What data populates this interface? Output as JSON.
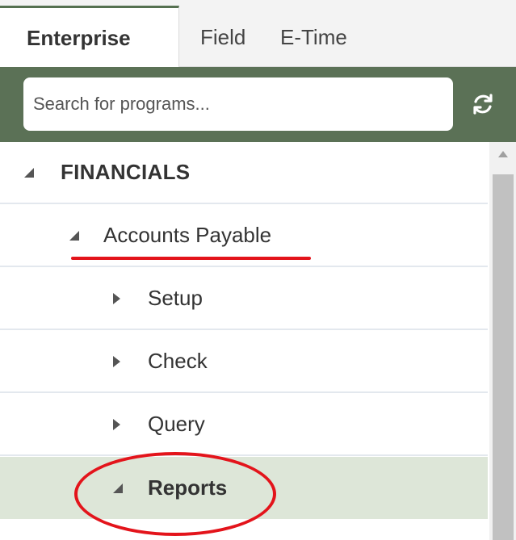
{
  "tabs": [
    {
      "label": "Enterprise",
      "active": true
    },
    {
      "label": "Field",
      "active": false
    },
    {
      "label": "E-Time",
      "active": false
    }
  ],
  "search": {
    "placeholder": "Search for programs...",
    "value": "",
    "refresh_icon": "refresh-icon"
  },
  "tree": {
    "items": [
      {
        "label": "FINANCIALS",
        "expanded": true,
        "icon": "caret-expanded-icon"
      },
      {
        "label": "Accounts Payable",
        "expanded": true,
        "icon": "caret-expanded-icon"
      },
      {
        "label": "Setup",
        "expanded": false,
        "icon": "caret-collapsed-icon"
      },
      {
        "label": "Check",
        "expanded": false,
        "icon": "caret-collapsed-icon"
      },
      {
        "label": "Query",
        "expanded": false,
        "icon": "caret-collapsed-icon"
      },
      {
        "label": "Reports",
        "expanded": true,
        "selected": true,
        "icon": "caret-expanded-icon"
      }
    ]
  },
  "colors": {
    "toolbar_green": "#5b7156",
    "selected_row": "#dde6d8",
    "annotation_red": "#e3141b"
  },
  "annotations": {
    "underline_target": "Accounts Payable",
    "circle_target": "Reports"
  }
}
